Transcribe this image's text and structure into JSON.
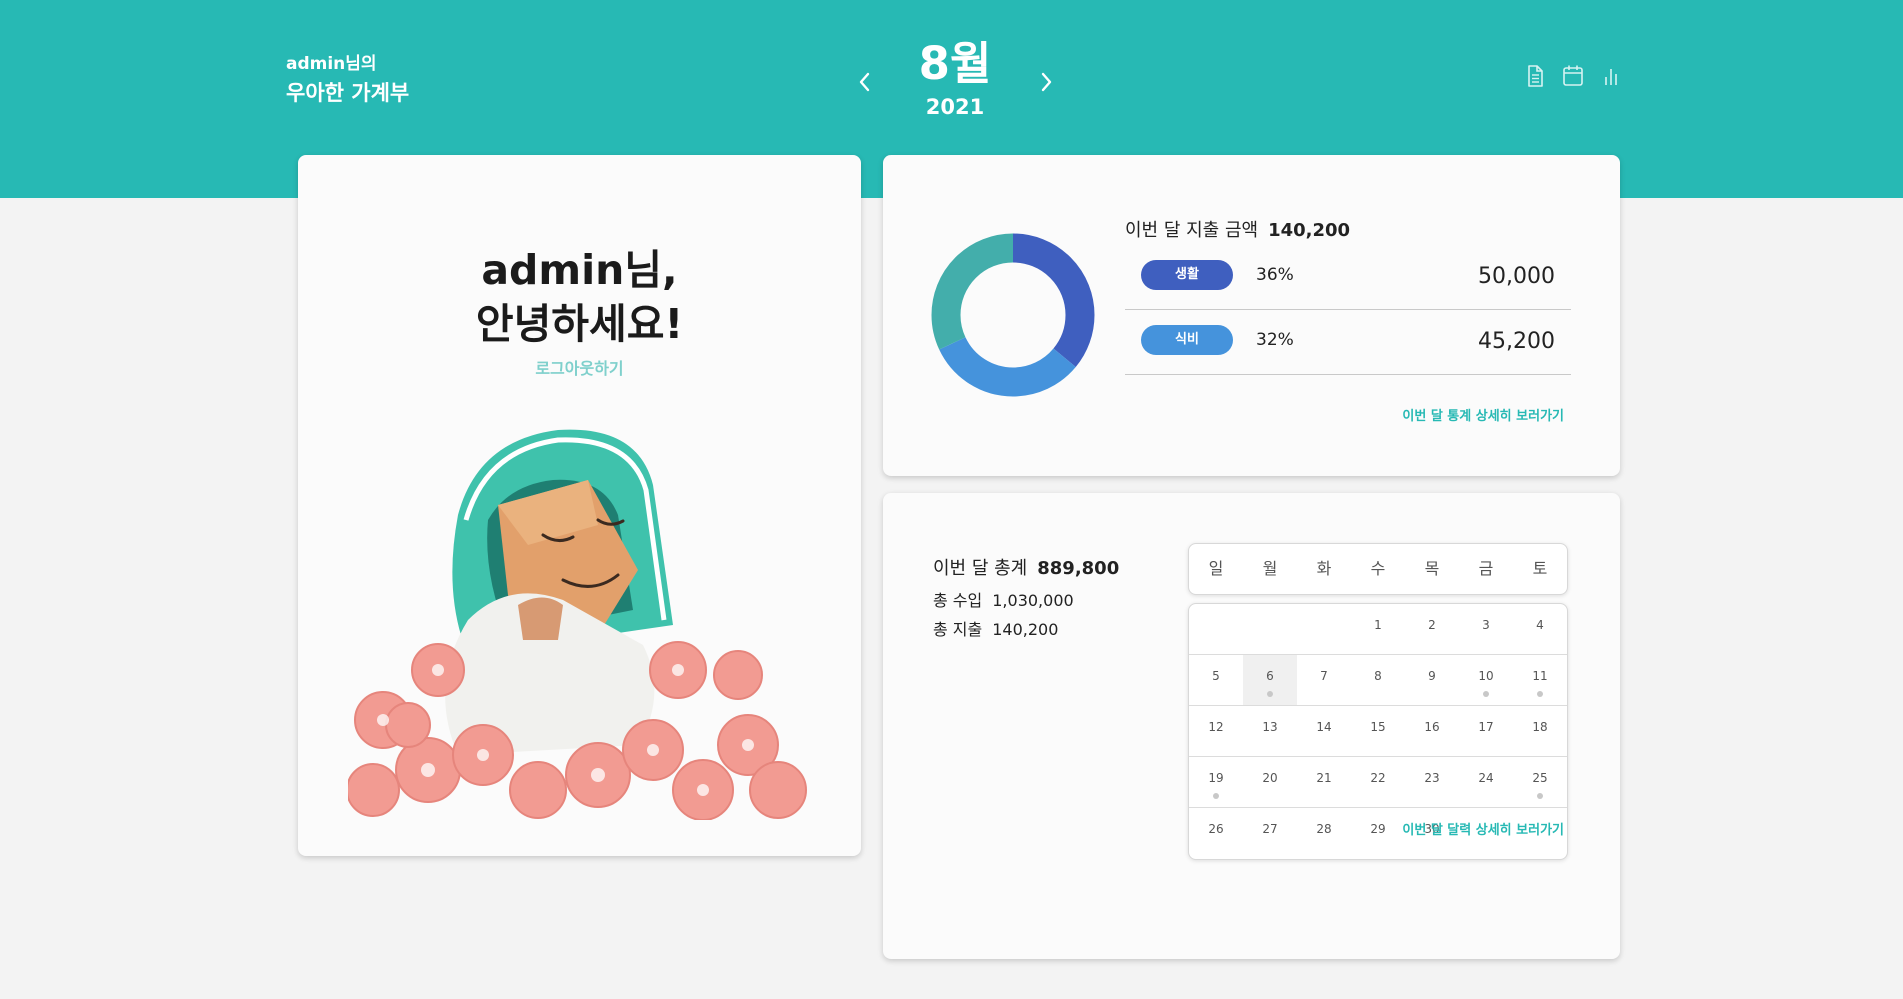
{
  "header": {
    "brand_line1": "admin님의",
    "brand_line2": "우아한 가계부",
    "month": "8월",
    "year": "2021",
    "colors": {
      "primary": "#27b9b4"
    },
    "icons": [
      "document-icon",
      "calendar-icon",
      "chart-icon"
    ]
  },
  "profile": {
    "greeting_line1": "admin님,",
    "greeting_line2": "안녕하세요!",
    "logout": "로그아웃하기"
  },
  "stats": {
    "title": "이번 달 지출 금액",
    "total": "140,200",
    "categories": [
      {
        "label": "생활",
        "percent": "36%",
        "amount": "50,000",
        "color": "#3f5fbf"
      },
      {
        "label": "식비",
        "percent": "32%",
        "amount": "45,200",
        "color": "#4593dc"
      }
    ],
    "donut": [
      {
        "label": "생활",
        "share": 0.36,
        "color": "#3f5fbf"
      },
      {
        "label": "식비",
        "share": 0.32,
        "color": "#4593dc"
      },
      {
        "label": "",
        "share": 0.32,
        "color": "#43aeab"
      }
    ],
    "link": "이번 달 통계 상세히 보러가기"
  },
  "summary": {
    "title": "이번 달 총계",
    "total": "889,800",
    "income_label": "총 수입",
    "income": "1,030,000",
    "expense_label": "총 지출",
    "expense": "140,200",
    "link": "이번 달 달력 상세히 보러가기"
  },
  "calendar": {
    "weekdays": [
      "일",
      "월",
      "화",
      "수",
      "목",
      "금",
      "토"
    ],
    "weeks": [
      [
        "",
        "",
        "",
        "1",
        "2",
        "3",
        "4"
      ],
      [
        "5",
        "6",
        "7",
        "8",
        "9",
        "10",
        "11"
      ],
      [
        "12",
        "13",
        "14",
        "15",
        "16",
        "17",
        "18"
      ],
      [
        "19",
        "20",
        "21",
        "22",
        "23",
        "24",
        "25"
      ],
      [
        "26",
        "27",
        "28",
        "29",
        "30",
        "",
        ""
      ]
    ],
    "today": "6",
    "dot_days": [
      "6",
      "10",
      "11",
      "19",
      "25"
    ]
  }
}
